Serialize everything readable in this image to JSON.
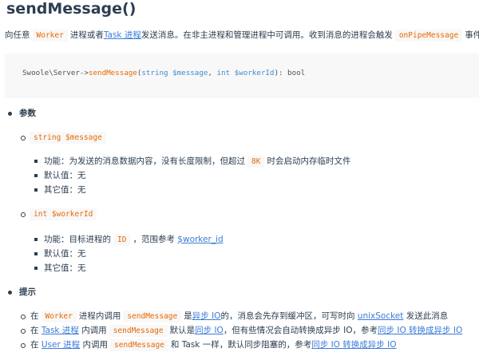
{
  "title": "sendMessage()",
  "intro": {
    "t1": "向任意",
    "code_worker": "Worker",
    "t2": "进程或者",
    "link_task": "Task 进程",
    "t3": "发送消息。在非主进程和管理进程中可调用。收到消息的进程会触发",
    "code_onpipe": "onPipeMessage",
    "t4": "事件。"
  },
  "signature": {
    "prefix": "Swoole\\Server->",
    "fn": "sendMessage",
    "open": "(",
    "type1": "string",
    "var1": "$message",
    "comma": ", ",
    "type2": "int",
    "var2": "$workerId",
    "close": "): bool"
  },
  "params_heading": "参数",
  "param1": {
    "name": "string $message",
    "func_prefix": "功能：为发送的消息数据内容，没有长度限制，但超过",
    "func_code": "8K",
    "func_suffix": "时会启动内存临时文件",
    "default": "默认值：无",
    "other": "其它值：无"
  },
  "param2": {
    "name": "int $workerId",
    "func_prefix": "功能：目标进程的",
    "func_code": "ID",
    "func_mid": "，范围参考",
    "func_link": "$worker_id",
    "default": "默认值：无",
    "other": "其它值：无"
  },
  "tips_heading": "提示",
  "tip1": {
    "t1": "在",
    "code1": "Worker",
    "t2": "进程内调用",
    "code2": "sendMessage",
    "t3": "是",
    "link1": "异步 IO",
    "t4": "的，消息会先存到缓冲区，可写时向",
    "link2": "unixSocket",
    "t5": "发送此消息"
  },
  "tip2": {
    "t1": "在",
    "link1": "Task 进程",
    "t2": "内调用",
    "code1": "sendMessage",
    "t3": "默认是",
    "link2": "同步 IO",
    "t4": "，但有些情况会自动转换成异步 IO，参考",
    "link3": "同步 IO 转换成异步 IO"
  },
  "tip3": {
    "t1": "在",
    "link1": "User 进程",
    "t2": "内调用",
    "code1": "sendMessage",
    "t3": "和 Task 一样，默认同步阻塞的，参考",
    "link2": "同步 IO 转换成异步 IO"
  }
}
